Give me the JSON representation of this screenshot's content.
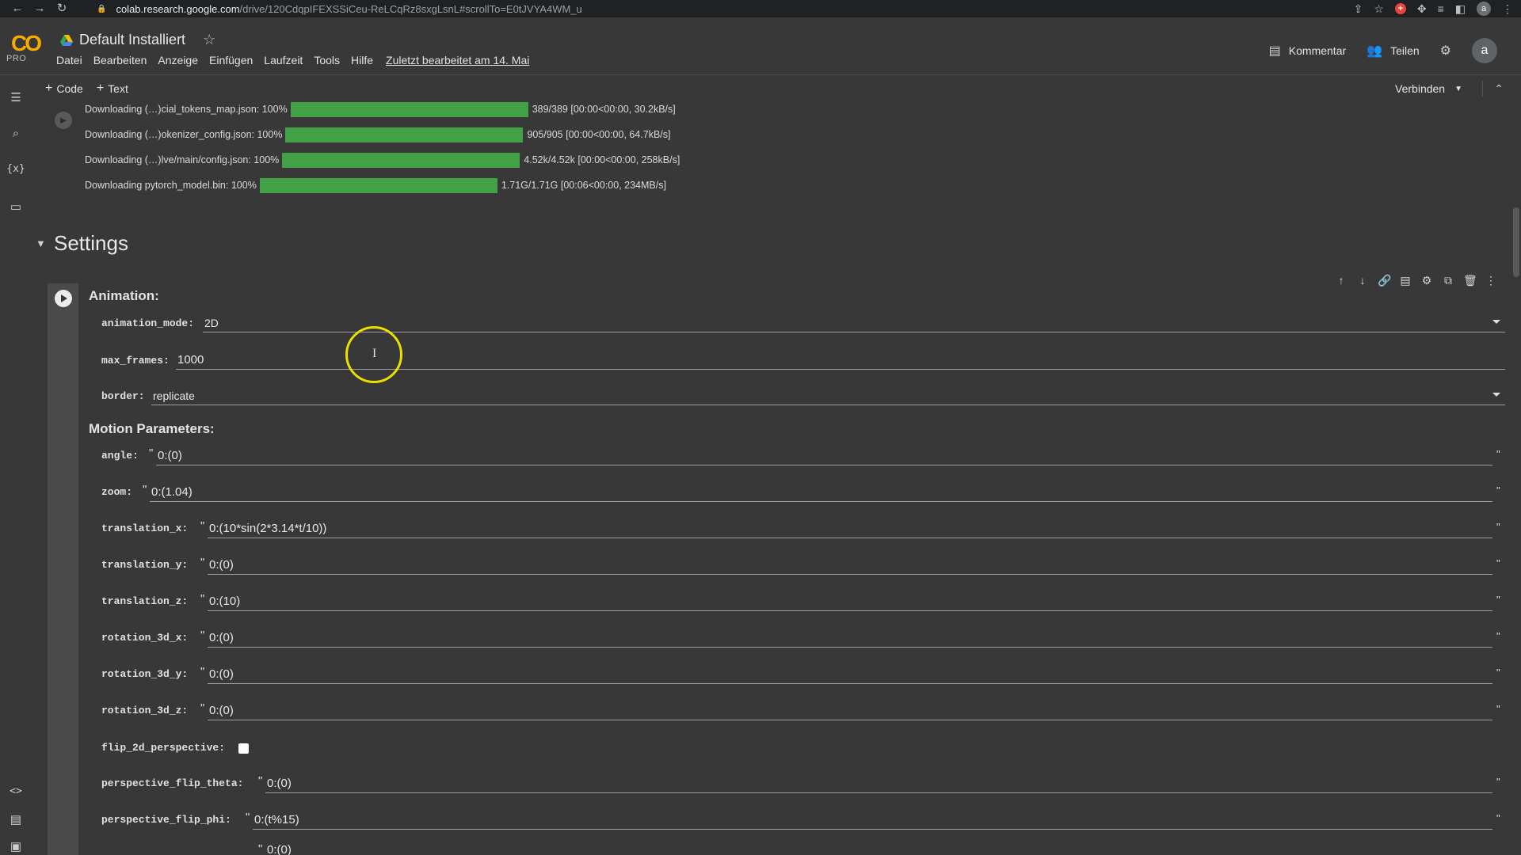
{
  "browser": {
    "url_domain": "colab.research.google.com",
    "url_path": "/drive/120CdqpIFEXSSiCeu-ReLCqRz8sxgLsnL#scrollTo=E0tJVYA4WM_u",
    "back_icon": "arrow-left-icon",
    "forward_icon": "arrow-right-icon",
    "reload_icon": "reload-icon",
    "avatar_letter": "a"
  },
  "header": {
    "logo_text": "CO",
    "logo_sub": "PRO",
    "title": "Default Installiert",
    "menu": [
      "Datei",
      "Bearbeiten",
      "Anzeige",
      "Einfügen",
      "Laufzeit",
      "Tools",
      "Hilfe"
    ],
    "last_edited": "Zuletzt bearbeitet am 14. Mai",
    "comment_label": "Kommentar",
    "share_label": "Teilen",
    "avatar_letter": "a"
  },
  "toolbar": {
    "add_code": "Code",
    "add_text": "Text",
    "connect_label": "Verbinden"
  },
  "downloads": [
    {
      "label": "Downloading (…)cial_tokens_map.json: 100%",
      "stats": "389/389 [00:00<00:00, 30.2kB/s]",
      "progress": 1.0
    },
    {
      "label": "Downloading (…)okenizer_config.json: 100%",
      "stats": "905/905 [00:00<00:00, 64.7kB/s]",
      "progress": 1.0
    },
    {
      "label": "Downloading (…)lve/main/config.json: 100%",
      "stats": "4.52k/4.52k [00:00<00:00, 258kB/s]",
      "progress": 1.0
    },
    {
      "label": "Downloading pytorch_model.bin: 100%",
      "stats": "1.71G/1.71G [00:06<00:00, 234MB/s]",
      "progress": 1.0
    }
  ],
  "section": {
    "title": "Settings"
  },
  "form": {
    "animation_heading": "Animation:",
    "motion_heading": "Motion Parameters:",
    "animation_mode": {
      "label": "animation_mode:",
      "value": "2D"
    },
    "max_frames": {
      "label": "max_frames:",
      "value": "1000"
    },
    "border": {
      "label": "border:",
      "value": "replicate"
    },
    "angle": {
      "label": "angle:",
      "value": "0:(0)"
    },
    "zoom": {
      "label": "zoom:",
      "value": "0:(1.04)"
    },
    "translation_x": {
      "label": "translation_x:",
      "value": "0:(10*sin(2*3.14*t/10))"
    },
    "translation_y": {
      "label": "translation_y:",
      "value": "0:(0)"
    },
    "translation_z": {
      "label": "translation_z:",
      "value": "0:(10)"
    },
    "rotation_3d_x": {
      "label": "rotation_3d_x:",
      "value": "0:(0)"
    },
    "rotation_3d_y": {
      "label": "rotation_3d_y:",
      "value": "0:(0)"
    },
    "rotation_3d_z": {
      "label": "rotation_3d_z:",
      "value": "0:(0)"
    },
    "flip_2d_perspective": {
      "label": "flip_2d_perspective:",
      "checked": false
    },
    "perspective_flip_theta": {
      "label": "perspective_flip_theta:",
      "value": "0:(0)"
    },
    "perspective_flip_phi": {
      "label": "perspective_flip_phi:",
      "value": "0:(t%15)"
    },
    "perspective_flip_gamma_partial": {
      "value": "0:(0)"
    }
  },
  "colors": {
    "progress": "#42a047",
    "accent": "#f9ab00",
    "cursor_ring": "#e8e000"
  }
}
